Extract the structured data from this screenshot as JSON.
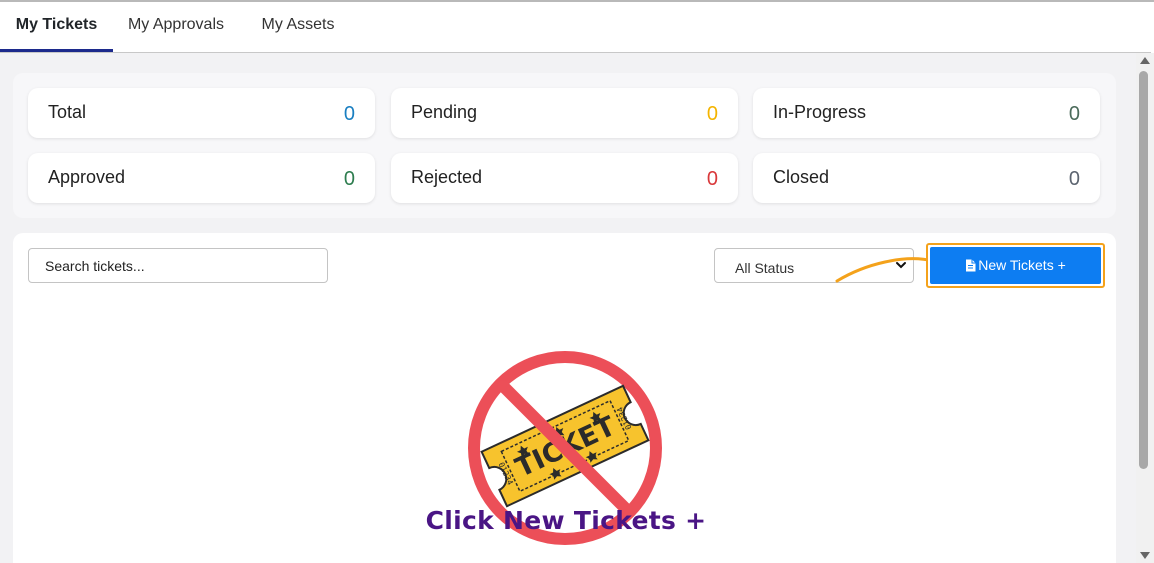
{
  "tabs": [
    {
      "label": "My Tickets",
      "active": true
    },
    {
      "label": "My Approvals",
      "active": false
    },
    {
      "label": "My Assets",
      "active": false
    }
  ],
  "stats": [
    {
      "label": "Total",
      "value": "0",
      "color": "#1a7fc1"
    },
    {
      "label": "Pending",
      "value": "0",
      "color": "#f4b400"
    },
    {
      "label": "In-Progress",
      "value": "0",
      "color": "#4b6b5b"
    },
    {
      "label": "Approved",
      "value": "0",
      "color": "#2e7d4f"
    },
    {
      "label": "Rejected",
      "value": "0",
      "color": "#d9383a"
    },
    {
      "label": "Closed",
      "value": "0",
      "color": "#5c6470"
    }
  ],
  "toolbar": {
    "search_placeholder": "Search tickets...",
    "status_filter": "All Status",
    "new_button_label": "New Tickets +",
    "new_button_icon": "file-icon"
  },
  "empty_state": {
    "icon": "no-ticket-icon",
    "cta": "Click New Tickets +"
  },
  "colors": {
    "accent": "#0d7df2",
    "highlight": "#f4a21b",
    "cta_text": "#4a1585"
  }
}
